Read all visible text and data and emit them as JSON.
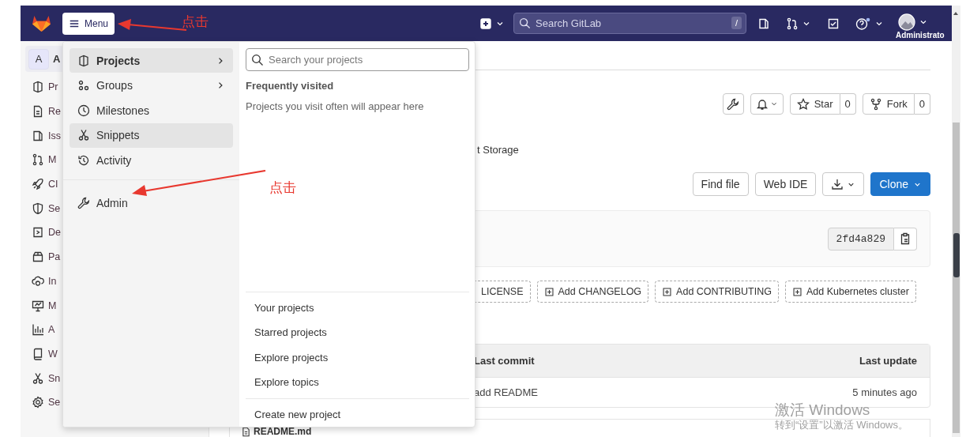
{
  "navbar": {
    "menu_button": "Menu",
    "search": {
      "placeholder": "Search GitLab",
      "shortcut": "/"
    },
    "user": "Administrato"
  },
  "sidebar": {
    "avatar": "A",
    "project": "A",
    "items": [
      "Pr",
      "Re",
      "Iss",
      "M",
      "CI",
      "Se",
      "De",
      "Pa",
      "In",
      "M",
      "A",
      "W",
      "Sn",
      "Se"
    ]
  },
  "menu": {
    "items": [
      {
        "label": "Projects",
        "selected": true,
        "hovered": false,
        "has_submenu": true
      },
      {
        "label": "Groups",
        "selected": false,
        "hovered": false,
        "has_submenu": true
      },
      {
        "label": "Milestones",
        "selected": false,
        "hovered": false,
        "has_submenu": false
      },
      {
        "label": "Snippets",
        "selected": false,
        "hovered": true,
        "has_submenu": false
      },
      {
        "label": "Activity",
        "selected": false,
        "hovered": false,
        "has_submenu": false
      }
    ],
    "admin": "Admin",
    "panel": {
      "search_placeholder": "Search your projects",
      "heading": "Frequently visited",
      "empty_text": "Projects you visit often will appear here",
      "links": [
        "Your projects",
        "Starred projects",
        "Explore projects",
        "Explore topics"
      ],
      "create": "Create new project"
    }
  },
  "project": {
    "star": {
      "label": "Star",
      "count": "0"
    },
    "fork": {
      "label": "Fork",
      "count": "0"
    },
    "description": "t Storage",
    "actions": [
      "Find file",
      "Web IDE"
    ],
    "clone": "Clone",
    "commit_sha": "2fd4a829",
    "add_buttons": [
      {
        "label": "LICENSE",
        "plus_icon": false
      },
      {
        "label": "Add CHANGELOG",
        "plus_icon": true
      },
      {
        "label": "Add CONTRIBUTING",
        "plus_icon": true
      },
      {
        "label": "Add Kubernetes cluster",
        "plus_icon": true
      }
    ],
    "table": {
      "columns": [
        "Last commit",
        "Last update"
      ],
      "rows": [
        {
          "last_commit": "add README",
          "last_update": "5 minutes ago"
        }
      ]
    },
    "readme": "README.md"
  },
  "annotations": [
    {
      "text": "点击"
    },
    {
      "text": "点击"
    }
  ],
  "os_overlay": {
    "title": "激活 Windows",
    "subtitle": "转到“设置”以激活 Windows。"
  }
}
